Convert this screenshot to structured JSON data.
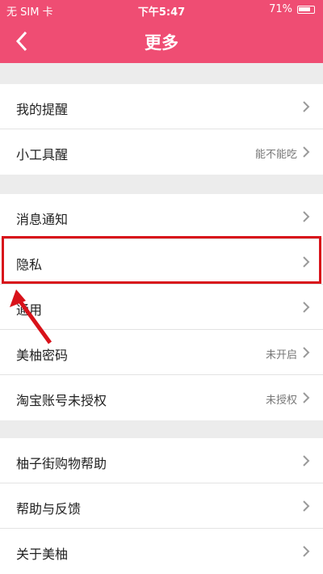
{
  "status_bar": {
    "carrier": "无 SIM 卡",
    "time": "下午5:47",
    "battery": "71%"
  },
  "nav": {
    "title": "更多"
  },
  "groups": [
    {
      "items": [
        {
          "label": "我的提醒",
          "value": ""
        },
        {
          "label": "小工具醒",
          "value": "能不能吃"
        }
      ]
    },
    {
      "items": [
        {
          "label": "消息通知",
          "value": ""
        },
        {
          "label": "隐私",
          "value": ""
        },
        {
          "label": "通用",
          "value": ""
        },
        {
          "label": "美柚密码",
          "value": "未开启"
        },
        {
          "label": "淘宝账号未授权",
          "value": "未授权"
        }
      ]
    },
    {
      "items": [
        {
          "label": "柚子街购物帮助",
          "value": ""
        },
        {
          "label": "帮助与反馈",
          "value": ""
        },
        {
          "label": "关于美柚",
          "value": ""
        }
      ]
    }
  ],
  "colors": {
    "nav_bg": "#ef4d73",
    "highlight": "#d8121a"
  }
}
